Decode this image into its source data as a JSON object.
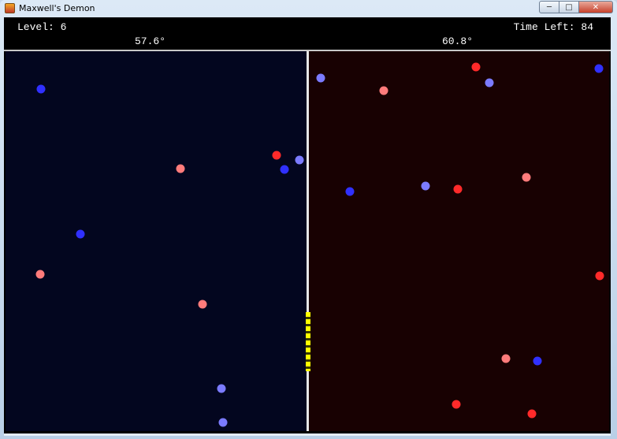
{
  "window": {
    "title": "Maxwell's Demon",
    "icon": "java-cup-icon"
  },
  "hud": {
    "level_text": "Level: 6",
    "time_left_text": "Time Left: 84",
    "left_temperature": "57.6°",
    "right_temperature": "60.8°"
  },
  "colors": {
    "left_chamber": "#03061f",
    "right_chamber": "#180102",
    "wall": "#e6e6e6",
    "door": "#ffff00",
    "fast_particle": "#ff2a2a",
    "warm_particle": "#ff7b7b",
    "slow_particle": "#3030ff",
    "cool_particle": "#7b7bff"
  },
  "door_state": "closed",
  "particles": {
    "note_types": [
      "fast",
      "warm",
      "slow",
      "cool"
    ],
    "left": [
      {
        "type": "slow"
      },
      {
        "type": "fast"
      },
      {
        "type": "warm"
      },
      {
        "type": "slow"
      },
      {
        "type": "cool"
      },
      {
        "type": "slow"
      },
      {
        "type": "warm"
      },
      {
        "type": "warm"
      },
      {
        "type": "cool"
      },
      {
        "type": "cool"
      }
    ],
    "right": [
      {
        "type": "fast"
      },
      {
        "type": "slow"
      },
      {
        "type": "cool"
      },
      {
        "type": "warm"
      },
      {
        "type": "cool"
      },
      {
        "type": "slow"
      },
      {
        "type": "cool"
      },
      {
        "type": "fast"
      },
      {
        "type": "warm"
      },
      {
        "type": "fast"
      },
      {
        "type": "warm"
      },
      {
        "type": "slow"
      },
      {
        "type": "fast"
      },
      {
        "type": "fast"
      }
    ]
  }
}
